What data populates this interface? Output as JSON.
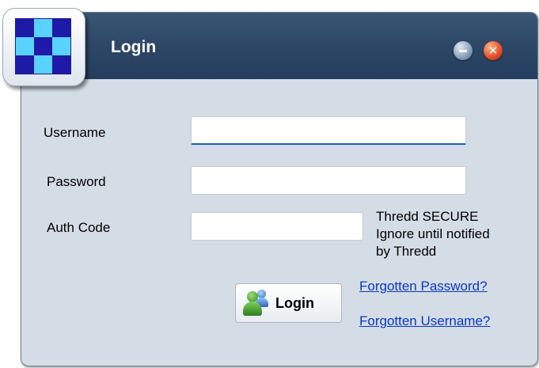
{
  "window": {
    "title": "Login",
    "close_glyph": "✕"
  },
  "form": {
    "username_label": "Username",
    "username_value": "",
    "password_label": "Password",
    "password_value": "",
    "authcode_label": "Auth Code",
    "authcode_value": "",
    "auth_note_line1": "Thredd SECURE",
    "auth_note_line2": "Ignore until notified",
    "auth_note_line3": "by Thredd"
  },
  "actions": {
    "login_label": "Login",
    "forgot_password": "Forgotten Password?",
    "forgot_username": "Forgotten Username?"
  },
  "icons": {
    "logo": "checkered-logo-icon",
    "minimize": "minimize-icon",
    "close": "close-icon",
    "login": "users-icon"
  },
  "colors": {
    "titlebar": "#2f4868",
    "window_bg": "#d4dde6",
    "link": "#0b37c8",
    "logo_dark": "#1d1aa8",
    "logo_light": "#5ad2ff"
  }
}
